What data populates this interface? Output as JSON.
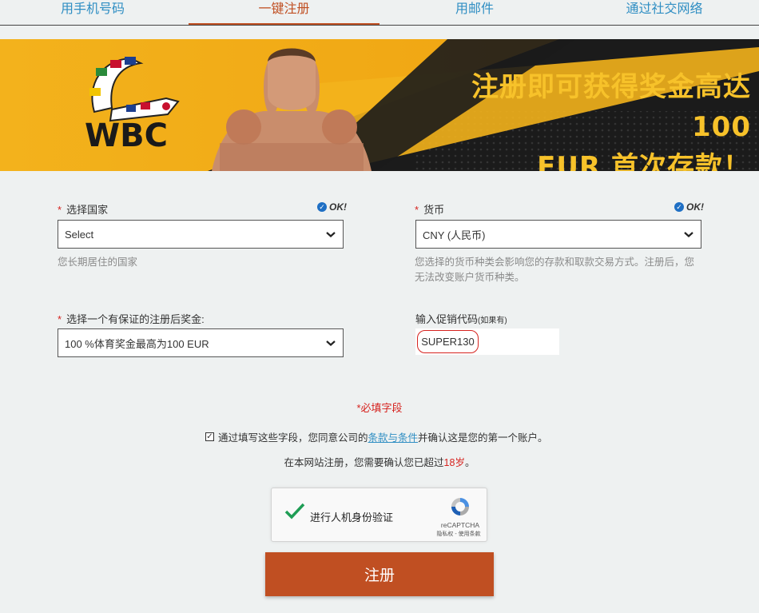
{
  "tabs": [
    {
      "label": "用手机号码",
      "active": false
    },
    {
      "label": "一键注册",
      "active": true
    },
    {
      "label": "用邮件",
      "active": false
    },
    {
      "label": "通过社交网络",
      "active": false
    }
  ],
  "banner": {
    "headline_line1": "注册即可获得奖金高达 100",
    "headline_line2": "EUR 首次存款！",
    "logo_text": "WBC",
    "accent_color": "#f7c22a"
  },
  "form": {
    "country": {
      "label": "选择国家",
      "required_mark": "*",
      "ok_text": "OK!",
      "value": "Select",
      "hint": "您长期居住的国家"
    },
    "currency": {
      "label": "货币",
      "required_mark": "*",
      "ok_text": "OK!",
      "value": "CNY (人民币)",
      "hint_line1": "您选择的货币种类会影响您的存款和取款交易方式。注册后，您",
      "hint_line2": "无法改变账户货币种类。"
    },
    "bonus": {
      "label": "选择一个有保证的注册后奖金:",
      "required_mark": "*",
      "value": "100 %体育奖金最高为100 EUR"
    },
    "promo": {
      "label": "输入促销代码",
      "label_suffix": "(如果有)",
      "value": "SUPER130"
    },
    "required_note": "*必填字段",
    "agree": {
      "checked": true,
      "checkmark": "✓",
      "text_before": "通过填写这些字段，您同意公司的",
      "link": "条款与条件",
      "text_after": " 并确认这是您的第一个账户。"
    },
    "age": {
      "text_before": "在本网站注册，您需要确认您已超过",
      "highlight": "18岁",
      "text_after": "。"
    },
    "captcha": {
      "label": "进行人机身份验证",
      "brand": "reCAPTCHA",
      "terms": "隐私权 - 使用条款"
    },
    "submit_label": "注册"
  },
  "colors": {
    "brand": "#c04f22",
    "link": "#2f8ec3",
    "required": "#d6231f"
  }
}
